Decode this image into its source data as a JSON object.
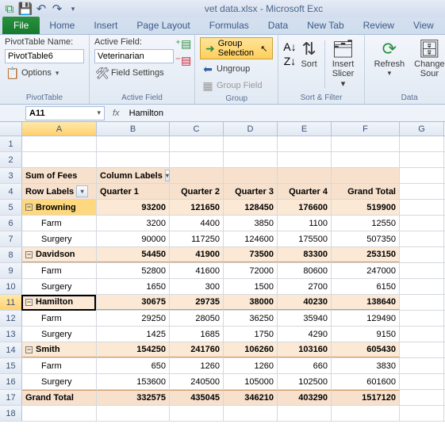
{
  "title": "vet data.xlsx - Microsoft Exc",
  "tabs": {
    "file": "File",
    "home": "Home",
    "insert": "Insert",
    "pagelayout": "Page Layout",
    "formulas": "Formulas",
    "data": "Data",
    "newtab": "New Tab",
    "review": "Review",
    "view": "View"
  },
  "ribbon": {
    "pivot": {
      "name_label": "PivotTable Name:",
      "name": "PivotTable6",
      "options": "Options",
      "group": "PivotTable"
    },
    "activefield": {
      "label": "Active Field:",
      "value": "Veterinarian",
      "settings": "Field Settings",
      "group": "Active Field"
    },
    "groupgrp": {
      "sel": "Group Selection",
      "ungroup": "Ungroup",
      "field": "Group Field",
      "group": "Group"
    },
    "sortfilter": {
      "sort": "Sort",
      "slicer": "Insert Slicer",
      "group": "Sort & Filter"
    },
    "data": {
      "refresh": "Refresh",
      "change": "Change Sour",
      "group": "Data"
    }
  },
  "namebox": "A11",
  "formula": "Hamilton",
  "cols": [
    "A",
    "B",
    "C",
    "D",
    "E",
    "F",
    "G"
  ],
  "pivot": {
    "measure": "Sum of Fees",
    "collabel": "Column Labels",
    "rowlabel": "Row Labels",
    "quarters": [
      "Quarter 1",
      "Quarter 2",
      "Quarter 3",
      "Quarter 4"
    ],
    "grandtotal": "Grand Total",
    "rows": [
      {
        "name": "Browning",
        "vals": [
          93200,
          121650,
          128450,
          176600,
          519900
        ],
        "children": [
          {
            "name": "Farm",
            "vals": [
              3200,
              4400,
              3850,
              1100,
              12550
            ]
          },
          {
            "name": "Surgery",
            "vals": [
              90000,
              117250,
              124600,
              175500,
              507350
            ]
          }
        ]
      },
      {
        "name": "Davidson",
        "vals": [
          54450,
          41900,
          73500,
          83300,
          253150
        ],
        "children": [
          {
            "name": "Farm",
            "vals": [
              52800,
              41600,
              72000,
              80600,
              247000
            ]
          },
          {
            "name": "Surgery",
            "vals": [
              1650,
              300,
              1500,
              2700,
              6150
            ]
          }
        ]
      },
      {
        "name": "Hamilton",
        "vals": [
          30675,
          29735,
          38000,
          40230,
          138640
        ],
        "children": [
          {
            "name": "Farm",
            "vals": [
              29250,
              28050,
              36250,
              35940,
              129490
            ]
          },
          {
            "name": "Surgery",
            "vals": [
              1425,
              1685,
              1750,
              4290,
              9150
            ]
          }
        ]
      },
      {
        "name": "Smith",
        "vals": [
          154250,
          241760,
          106260,
          103160,
          605430
        ],
        "children": [
          {
            "name": "Farm",
            "vals": [
              650,
              1260,
              1260,
              660,
              3830
            ]
          },
          {
            "name": "Surgery",
            "vals": [
              153600,
              240500,
              105000,
              102500,
              601600
            ]
          }
        ]
      }
    ],
    "grand": [
      332575,
      435045,
      346210,
      403290,
      1517120
    ]
  }
}
